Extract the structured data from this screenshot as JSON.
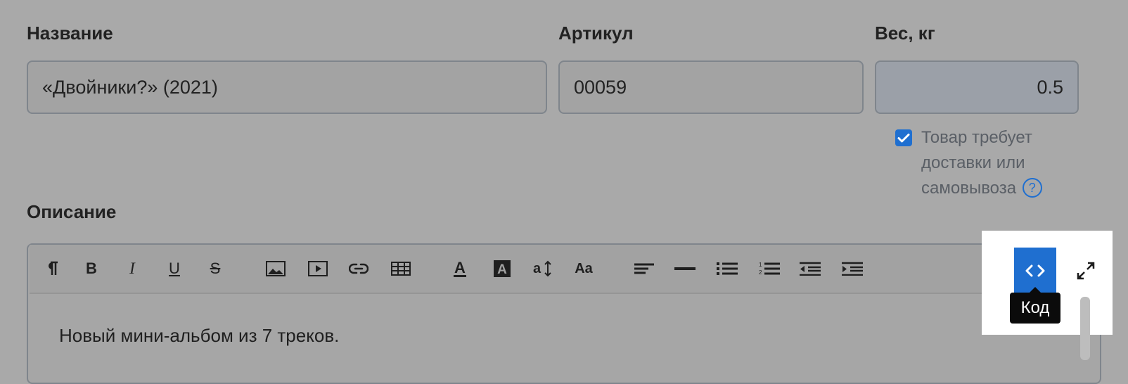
{
  "fields": {
    "name": {
      "label": "Название",
      "value": "«Двойники?» (2021)"
    },
    "sku": {
      "label": "Артикул",
      "value": "00059"
    },
    "weight": {
      "label": "Вес, кг",
      "value": "0.5"
    }
  },
  "shipping": {
    "checked": true,
    "label": "Товар требует доставки или самовывоза",
    "help_icon": "question-circle-icon"
  },
  "description": {
    "label": "Описание",
    "content": "Новый мини-альбом из 7 треков.",
    "toolbar": {
      "buttons": [
        {
          "name": "paragraph",
          "icon": "paragraph-icon"
        },
        {
          "name": "bold",
          "icon": "bold-icon"
        },
        {
          "name": "italic",
          "icon": "italic-icon"
        },
        {
          "name": "underline",
          "icon": "underline-icon"
        },
        {
          "name": "strikethrough",
          "icon": "strikethrough-icon"
        },
        {
          "name": "image",
          "icon": "image-icon"
        },
        {
          "name": "video",
          "icon": "video-icon"
        },
        {
          "name": "link",
          "icon": "link-icon"
        },
        {
          "name": "table",
          "icon": "table-icon"
        },
        {
          "name": "font-color",
          "icon": "font-color-icon"
        },
        {
          "name": "background-color",
          "icon": "background-color-icon"
        },
        {
          "name": "font-size",
          "icon": "font-size-icon"
        },
        {
          "name": "font-family",
          "icon": "font-family-icon"
        },
        {
          "name": "align",
          "icon": "align-left-icon"
        },
        {
          "name": "horizontal-rule",
          "icon": "horizontal-rule-icon"
        },
        {
          "name": "bullet-list",
          "icon": "bullet-list-icon"
        },
        {
          "name": "numbered-list",
          "icon": "numbered-list-icon"
        },
        {
          "name": "outdent",
          "icon": "outdent-icon"
        },
        {
          "name": "indent",
          "icon": "indent-icon"
        }
      ],
      "code_button": {
        "icon": "code-icon",
        "tooltip": "Код",
        "active": true
      },
      "fullscreen_button": {
        "icon": "expand-icon"
      }
    }
  },
  "colors": {
    "accent": "#1f6fd0",
    "overlay": "#a9a9a9",
    "tooltip_bg": "#0b0b0b"
  }
}
